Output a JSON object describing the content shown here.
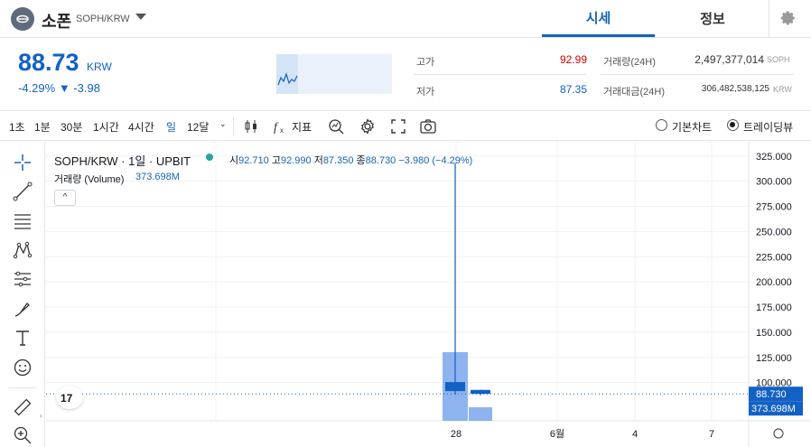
{
  "header": {
    "coin_name": "소폰",
    "coin_symbol": "SOPH/KRW",
    "tabs": [
      "시세",
      "정보"
    ]
  },
  "price": {
    "current": "88.73",
    "unit": "KRW",
    "change_pct": "-4.29%",
    "change_abs": "▼ -3.98"
  },
  "stats": {
    "high_label": "고가",
    "high_value": "92.99",
    "low_label": "저가",
    "low_value": "87.35",
    "volume_label": "거래량(24H)",
    "volume_value": "2,497,377,014",
    "volume_unit": "SOPH",
    "amount_label": "거래대금(24H)",
    "amount_value": "306,482,538,125",
    "amount_unit": "KRW"
  },
  "toolbar": {
    "intervals": [
      "1초",
      "1분",
      "30분",
      "1시간",
      "4시간",
      "일",
      "12달"
    ],
    "active_interval": "일",
    "indicator_label": "지표",
    "basic_chart_label": "기본차트",
    "tradingview_label": "트레이딩뷰",
    "selected_view": "트레이딩뷰"
  },
  "legend": {
    "title": "SOPH/KRW · 1일 · UPBIT",
    "open_label": "시",
    "open": "92.710",
    "high_label": "고",
    "high": "92.990",
    "low_label": "저",
    "low": "87.350",
    "close_label": "종",
    "close": "88.730",
    "change": "−3.980 (−4.29%)",
    "volume_label": "거래량 (Volume)",
    "volume_value": "373.698M"
  },
  "chart_data": {
    "type": "candlestick",
    "price_axis_ticks": [
      "325.000",
      "300.000",
      "275.000",
      "250.000",
      "225.000",
      "200.000",
      "175.000",
      "150.000",
      "125.000",
      "100.000"
    ],
    "time_axis_ticks": [
      "28",
      "6월",
      "4",
      "7"
    ],
    "ylim": [
      62,
      332
    ],
    "candles": [
      {
        "x": "28",
        "open": 100.5,
        "high": 318,
        "low": 88,
        "close": 91.5,
        "volume": 0.76
      },
      {
        "x": "29",
        "open": 92.71,
        "high": 92.99,
        "low": 87.35,
        "close": 88.73,
        "volume": 0.15
      }
    ],
    "last_price_label": "88.730",
    "last_volume_label": "373.698M",
    "colors": {
      "candle": "#1261c4",
      "volume": "#7aa7ec",
      "last_price_bg": "#1261c4"
    }
  }
}
